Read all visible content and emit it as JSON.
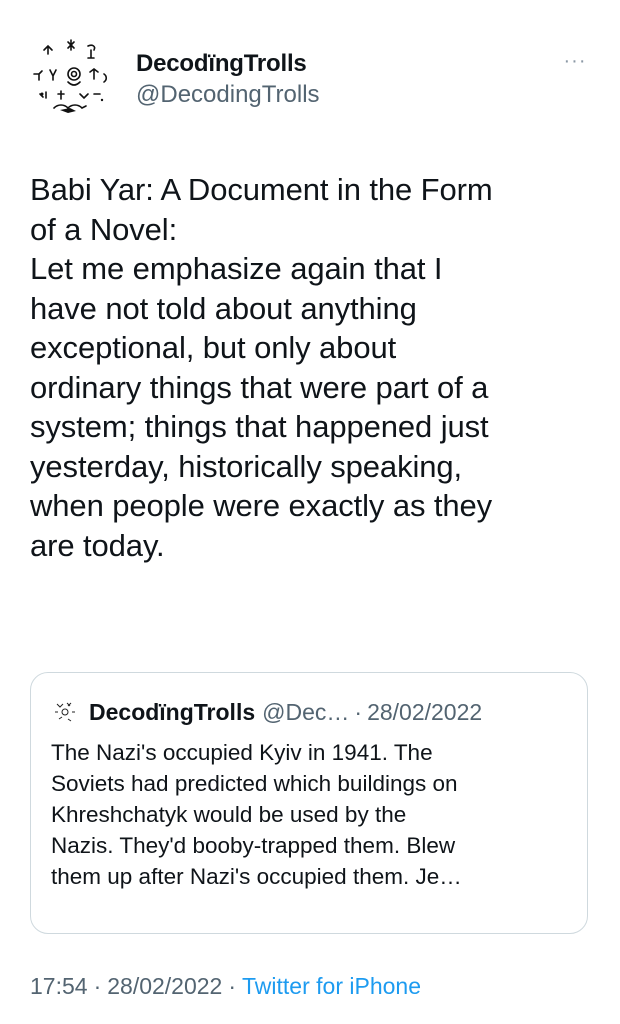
{
  "author": {
    "display_name": "DecodïngTrolls",
    "handle": "@DecodingTrolls",
    "avatar_icon": "petroglyph-symbols-avatar-icon"
  },
  "tweet": {
    "text": "Babi Yar: A Document in the Form\nof a Novel:\nLet me emphasize again that I\nhave not told about anything\nexceptional, but only about\nordinary things that were part of a\nsystem; things that happened just\nyesterday, historically speaking,\nwhen people were exactly as they\nare today."
  },
  "quoted_tweet": {
    "display_name": "DecodïngTrolls",
    "handle": "@Dec…",
    "separator": "·",
    "date": "28/02/2022",
    "text": "The Nazi's occupied Kyiv in 1941. The\nSoviets had predicted which buildings on\nKhreshchatyk would be used by the\nNazis. They'd booby-trapped them. Blew\nthem up after Nazi's occupied them. Je…"
  },
  "footer": {
    "time": "17:54",
    "separator": "·",
    "date": "28/02/2022",
    "source": "Twitter for iPhone"
  },
  "more_icon": "···",
  "colors": {
    "text": "#0f1419",
    "secondary": "#536471",
    "link": "#1d9bf0",
    "border": "#cfd9de"
  }
}
